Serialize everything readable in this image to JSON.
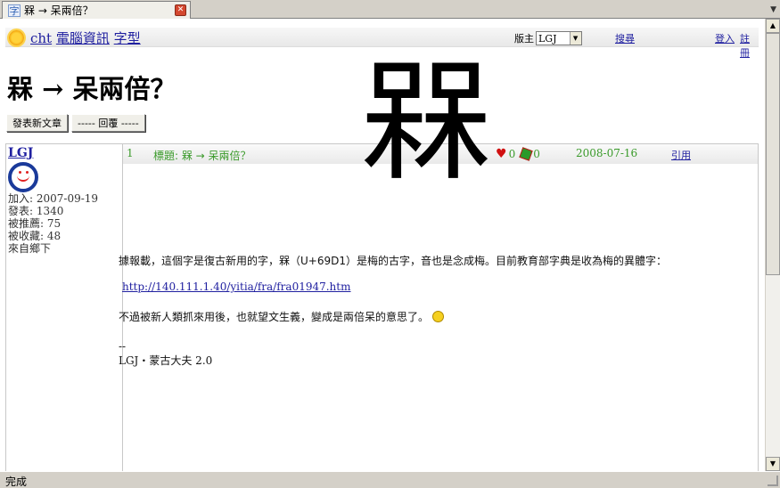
{
  "tab": {
    "title": "槑 → 呆兩倍？",
    "favicon_char": "字"
  },
  "nav": {
    "links": [
      "cht",
      "電腦資訊",
      "字型"
    ],
    "moderator_label": "版主",
    "moderator_value": "LGJ",
    "search": "搜尋",
    "login": "登入",
    "register": "註冊"
  },
  "page": {
    "title": "槑 → 呆兩倍？",
    "new_post_button": "發表新文章",
    "reply_button": "----- 回覆 -----"
  },
  "post": {
    "number": "1",
    "subject": "標題: 槑 → 呆兩倍？",
    "likes": "0",
    "gifts": "0",
    "date": "2008-07-16",
    "quote": "引用",
    "big_char": "槑",
    "line1": "據報載，這個字是復古新用的字，槑（U+69D1）是梅的古字，音也是念成梅。目前教育部字典是收為梅的異體字：",
    "link": "http://140.111.1.40/yitia/fra/fra01947.htm",
    "line3": "不過被新人類抓來用後，也就望文生義，變成是兩倍呆的意思了。",
    "sig_sep": "--",
    "sig": "LGJ・蒙古大夫 2.0"
  },
  "author": {
    "name": "LGJ",
    "joined": "加入: 2007-09-19",
    "posts": "發表: 1340",
    "recommended": "被推薦: 75",
    "favorited": "被收藏: 48",
    "from": "來自鄉下"
  },
  "status": {
    "text": "完成"
  },
  "colors": {
    "link": "#2020a0",
    "header_green": "#3a9a2a",
    "heart": "#d01010"
  }
}
